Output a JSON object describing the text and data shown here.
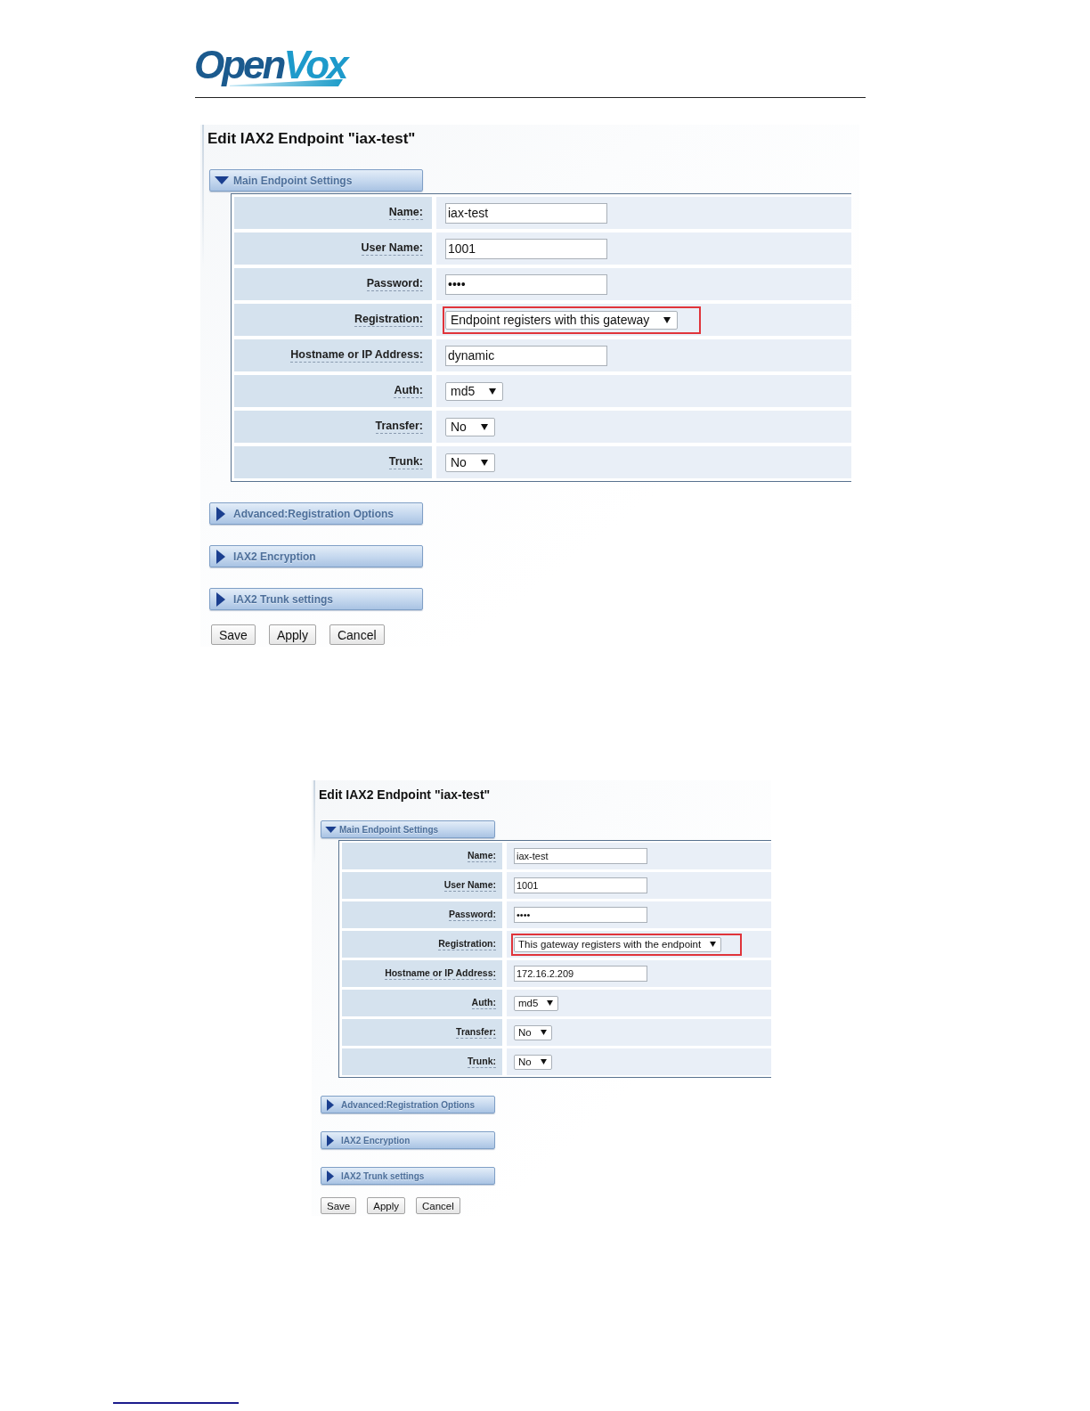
{
  "logo": {
    "first": "Open",
    "second": "Vox"
  },
  "screenshots": [
    {
      "title": "Edit IAX2 Endpoint \"iax-test\"",
      "sections": [
        {
          "label": "Main Endpoint Settings",
          "expanded": true,
          "fields": [
            {
              "label": "Name:",
              "kind": "text",
              "value": "iax-test",
              "highlighted": false
            },
            {
              "label": "User Name:",
              "kind": "text",
              "value": "1001",
              "highlighted": false
            },
            {
              "label": "Password:",
              "kind": "text",
              "value": "••••",
              "highlighted": false
            },
            {
              "label": "Registration:",
              "kind": "select",
              "value": "Endpoint registers with this gateway",
              "highlighted": true
            },
            {
              "label": "Hostname or IP Address:",
              "kind": "text",
              "value": "dynamic",
              "highlighted": false
            },
            {
              "label": "Auth:",
              "kind": "select",
              "value": "md5",
              "highlighted": false
            },
            {
              "label": "Transfer:",
              "kind": "select",
              "value": "No",
              "highlighted": false
            },
            {
              "label": "Trunk:",
              "kind": "select",
              "value": "No",
              "highlighted": false
            }
          ]
        },
        {
          "label": "Advanced:Registration Options",
          "expanded": false
        },
        {
          "label": "IAX2 Encryption",
          "expanded": false
        },
        {
          "label": "IAX2 Trunk settings",
          "expanded": false
        }
      ],
      "buttons": [
        "Save",
        "Apply",
        "Cancel"
      ]
    },
    {
      "title": "Edit IAX2 Endpoint \"iax-test\"",
      "sections": [
        {
          "label": "Main Endpoint Settings",
          "expanded": true,
          "fields": [
            {
              "label": "Name:",
              "kind": "text",
              "value": "iax-test",
              "highlighted": false
            },
            {
              "label": "User Name:",
              "kind": "text",
              "value": "1001",
              "highlighted": false
            },
            {
              "label": "Password:",
              "kind": "text",
              "value": "••••",
              "highlighted": false
            },
            {
              "label": "Registration:",
              "kind": "select",
              "value": "This gateway registers with the endpoint",
              "highlighted": true
            },
            {
              "label": "Hostname or IP Address:",
              "kind": "text",
              "value": "172.16.2.209",
              "highlighted": false
            },
            {
              "label": "Auth:",
              "kind": "select",
              "value": "md5",
              "highlighted": false
            },
            {
              "label": "Transfer:",
              "kind": "select",
              "value": "No",
              "highlighted": false
            },
            {
              "label": "Trunk:",
              "kind": "select",
              "value": "No",
              "highlighted": false
            }
          ]
        },
        {
          "label": "Advanced:Registration Options",
          "expanded": false
        },
        {
          "label": "IAX2 Encryption",
          "expanded": false
        },
        {
          "label": "IAX2 Trunk settings",
          "expanded": false
        }
      ],
      "buttons": [
        "Save",
        "Apply",
        "Cancel"
      ]
    }
  ]
}
